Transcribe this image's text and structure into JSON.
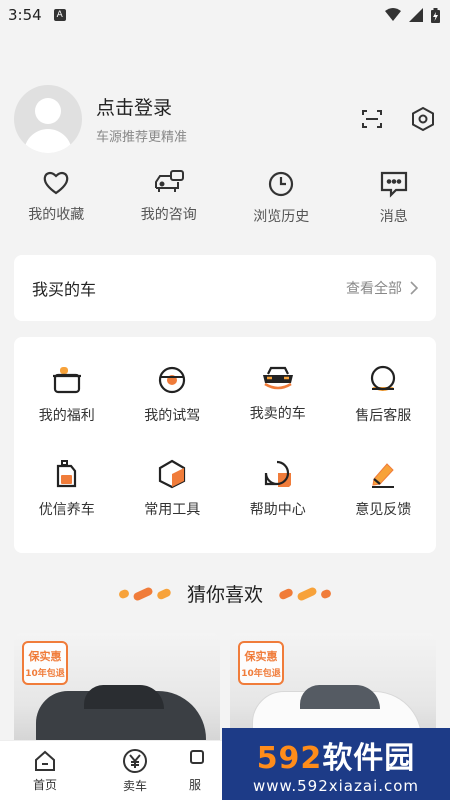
{
  "status_bar": {
    "time": "3:54",
    "notification_icon": "A"
  },
  "profile": {
    "login_text": "点击登录",
    "subtitle": "车源推荐更精准",
    "actions": [
      {
        "icon": "scan-icon"
      },
      {
        "icon": "settings-hexagon-icon"
      }
    ]
  },
  "quick_links": [
    {
      "label": "我的收藏",
      "icon": "heart-icon"
    },
    {
      "label": "我的咨询",
      "icon": "consult-car-icon"
    },
    {
      "label": "浏览历史",
      "icon": "clock-icon"
    },
    {
      "label": "消息",
      "icon": "message-icon"
    }
  ],
  "orders": {
    "title": "我买的车",
    "more_label": "查看全部"
  },
  "services": [
    {
      "label": "我的福利",
      "icon": "gift-box-icon"
    },
    {
      "label": "我的试驾",
      "icon": "steering-wheel-icon"
    },
    {
      "label": "我卖的车",
      "icon": "car-front-icon"
    },
    {
      "label": "售后客服",
      "icon": "customer-service-icon"
    },
    {
      "label": "优信养车",
      "icon": "oil-can-icon"
    },
    {
      "label": "常用工具",
      "icon": "cube-icon"
    },
    {
      "label": "帮助中心",
      "icon": "help-bubble-icon"
    },
    {
      "label": "意见反馈",
      "icon": "pencil-icon"
    }
  ],
  "recommend": {
    "title": "猜你喜欢"
  },
  "cars": [
    {
      "badge_line1": "保实惠",
      "badge_line2": "10年包退",
      "body_color": "#3b3f44"
    },
    {
      "badge_line1": "保实惠",
      "badge_line2": "10年包退",
      "body_color": "#f5f5f5"
    }
  ],
  "tabbar": {
    "items": [
      {
        "label": "首页",
        "icon": "home-icon"
      },
      {
        "label": "卖车",
        "icon": "yuan-icon"
      },
      {
        "label": "服",
        "icon": "service-icon"
      }
    ]
  },
  "watermark": {
    "brand_num": "592",
    "brand_text": "软件园",
    "url": "www.592xiazai.com"
  },
  "colors": {
    "accent": "#f07c3a",
    "orange": "#ff8c1a",
    "watermark_bg": "#1d3b87"
  }
}
